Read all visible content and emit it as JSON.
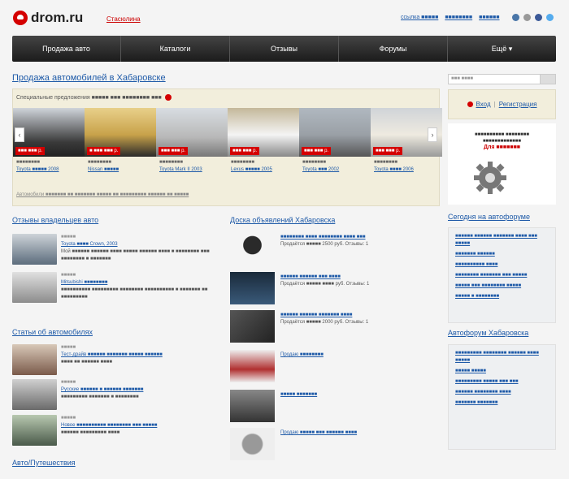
{
  "header": {
    "logo": "drom.ru",
    "city_link": "Стасюлина",
    "top_links": [
      "ссылка ■■■■■",
      "■■■■■■■■",
      "■■■■■■"
    ]
  },
  "nav": [
    "Продажа авто",
    "Каталоги",
    "Отзывы",
    "Форумы",
    "Ещё ▾"
  ],
  "main": {
    "title": "Продажа автомобилей в Хабаровске",
    "slider_head": "Специальные предложения ■■■■■ ■■■ ■■■■■■■■ ■■■",
    "slider_foot": "Автомобили ■■■■■■■ ■■ ■■■■■■■ ■■■■■ ■■ ■■■■■■■■■ ■■■■■■ ■■ ■■■■■",
    "cars": [
      {
        "price": "■■■ ■■■ р.",
        "year": "■■■■■■■■",
        "name": "Toyota ■■■■■ 2008",
        "color": "#3a3a3a"
      },
      {
        "price": "■ ■■■ ■■■ р.",
        "year": "■■■■■■■■",
        "name": "Nissan ■■■■■",
        "color": "#c8a24a"
      },
      {
        "price": "■■■ ■■■ р.",
        "year": "■■■■■■■■",
        "name": "Toyota Mark II 2003",
        "color": "#b8b8b8"
      },
      {
        "price": "■■■ ■■■ р.",
        "year": "■■■■■■■■",
        "name": "Lexus ■■■■■ 2005",
        "color": "#d6d9de"
      },
      {
        "price": "■■■ ■■■ р.",
        "year": "■■■■■■■■",
        "name": "Toyota ■■■ 2002",
        "color": "#9aa0a6"
      },
      {
        "price": "■■■ ■■■ р.",
        "year": "■■■■■■■■",
        "name": "Toyota ■■■■ 2006",
        "color": "#e6e2d6"
      }
    ]
  },
  "left": {
    "reviews_title": "Отзывы владельцев авто",
    "reviews": [
      {
        "date": "■■■■■",
        "title": "Toyota ■■■■ Crown, 2003",
        "text": "Мой ■■■■■■ ■■■■■■ ■■■■ ■■■■■ ■■■■■■ ■■■■ ■ ■■■■■■■■ ■■■ ■■■■■■■■ ■ ■■■■■■■",
        "color": "#5c6c7c"
      },
      {
        "date": "■■■■■",
        "title": "Mitsubishi ■■■■■■■■",
        "text": "■■■■■■■■■■ ■■■■■■■■■ ■■■■■■■■ ■■■■■■■■■■ ■ ■■■■■■■ ■■ ■■■■■■■■■",
        "color": "#8c8c8c"
      }
    ],
    "articles_title": "Статьи об автомобилях",
    "articles": [
      {
        "date": "■■■■■",
        "title": "Тест-драйв ■■■■■■ ■■■■■■■ ■■■■■ ■■■■■■",
        "text": "■■■■ ■■ ■■■■■■ ■■■■",
        "color": "#7a5a4a"
      },
      {
        "date": "■■■■■",
        "title": "Русские ■■■■■■ ■ ■■■■■■ ■■■■■■■",
        "text": "■■■■■■■■■ ■■■■■■■ ■ ■■■■■■■■",
        "color": "#6a6a6a"
      },
      {
        "date": "■■■■■",
        "title": "Новое ■■■■■■■■■■ ■■■■■■■■ ■■■ ■■■■■",
        "text": "■■■■■■ ■■■■■■■■■ ■■■■",
        "color": "#4a5a4a"
      }
    ],
    "bottom_title": "Авто/Путешествия"
  },
  "middle": {
    "title": "Доска объявлений Хабаровска",
    "items": [
      {
        "title": "■■■■■■■■ ■■■■ ■■■■■■■■ ■■■■ ■■■",
        "meta": "Продаётся ■■■■■ 2500 руб. Отзывы: 1",
        "color": "#2a2a2a"
      },
      {
        "title": "■■■■■■ ■■■■■■ ■■■ ■■■■",
        "meta": "Продаётся ■■■■■ ■■■■ руб. Отзывы: 1",
        "color": "#1a2a3a"
      },
      {
        "title": "■■■■■■ ■■■■■■ ■■■■■■■ ■■■■",
        "meta": "Продаётся ■■■■■ 2000 руб. Отзывы: 1",
        "color": "#3a3a3a"
      },
      {
        "title": "Продаю ■■■■■■■■",
        "meta": "",
        "color": "#b03030"
      },
      {
        "title": "■■■■■ ■■■■■■■",
        "meta": "",
        "color": "#555555"
      },
      {
        "title": "Продаю ■■■■■ ■■■ ■■■■■■ ■■■■",
        "meta": "",
        "color": "#777777"
      }
    ]
  },
  "right": {
    "search_placeholder": "■■■ ■■■■",
    "login": "Вход",
    "register": "Регистрация",
    "ad_text": "■■■■■■■■■■ ■■■■■■■■ ■■■■■■■■■■■■■",
    "ad_big": "Для ■■■■■■■",
    "forum_title": "Сегодня на автофоруме",
    "forum_items": [
      "■■■■■■ ■■■■■■ ■■■■■■■ ■■■■ ■■■ ■■■■■",
      "■■■■■■■ ■■■■■■",
      "■■■■■■■■■■ ■■■■",
      "■■■■■■■■ ■■■■■■■ ■■■ ■■■■■",
      "■■■■■ ■■■ ■■■■■■■■ ■■■■■",
      "■■■■■ ■ ■■■■■■■■"
    ],
    "autoforum_title": "Автофорум Хабаровска",
    "autoforum_items": [
      "■■■■■■■■■ ■■■■■■■■ ■■■■■■ ■■■■ ■■■■■",
      "■■■■■ ■■■■■",
      "■■■■■■■■■ ■■■■■ ■■■ ■■■",
      "■■■■■■ ■■■■■■■■ ■■■■",
      "■■■■■■■ ■■■■■■■"
    ]
  },
  "colors": {
    "accent": "#d40000",
    "link": "#1e5aa8",
    "nav_bg": "#2a2a2a",
    "panel": "#f2eedc"
  }
}
